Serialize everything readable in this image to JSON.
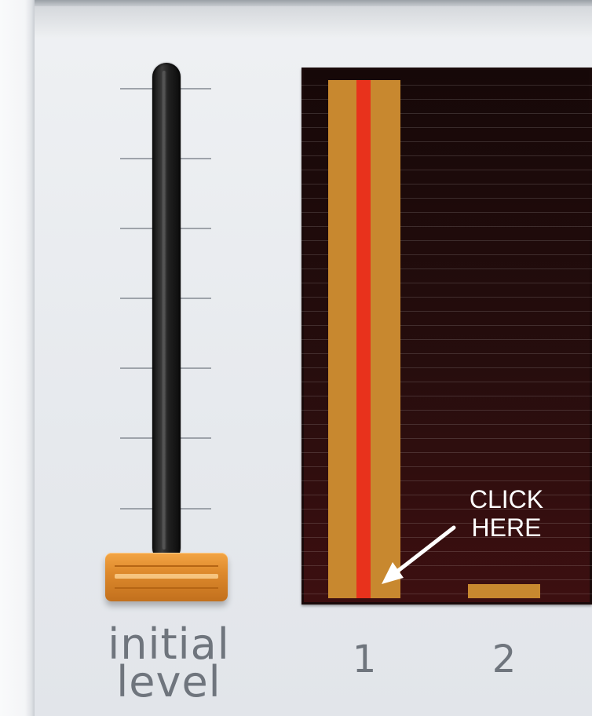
{
  "slider": {
    "label_line1": "initial",
    "label_line2": "level",
    "tick_count": 7,
    "level": 0
  },
  "graph": {
    "bars": [
      {
        "label": "1",
        "value": 1.0,
        "selected": true
      },
      {
        "label": "2",
        "value": 0.0,
        "selected": false
      }
    ],
    "annotation_line1": "CLICK",
    "annotation_line2": "HERE",
    "colors": {
      "bar": "#c8882f",
      "marker": "#e8321c",
      "background": "#260d0d",
      "annotation": "#ffffff"
    }
  }
}
